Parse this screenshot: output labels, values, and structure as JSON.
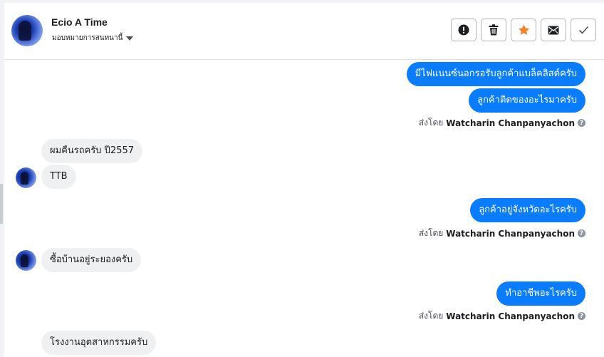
{
  "header": {
    "contact_name": "Ecio A Time",
    "assign_label": "มอบหมายการสนทนานี้"
  },
  "actions": {
    "spam_label": "!",
    "delete_label": "Delete",
    "star_label": "Star",
    "mail_label": "Mark unread",
    "done_label": "Done"
  },
  "messages": {
    "m1": "มีไฟแนนซ์นอกรอรับลูกค้าแบล็คลิสต์ครับ",
    "m2": "ลูกค้าติดของอะไรมาครับ",
    "m3": "ผมคืนรถครับ ปี2557",
    "m4": "TTB",
    "m5": "ลูกค้าอยู่จังหวัดอะไรครับ",
    "m6": "ซื้อบ้านอยู่ระยองครับ",
    "m7": "ทำอาชีพอะไรครับ",
    "m8": "โรงงานอุตสาหกรรมครับ"
  },
  "sent_by": {
    "prefix": "ส่งโดย",
    "agent": "Watcharin Chanpanyachon",
    "help": "?"
  },
  "colors": {
    "outgoing": "#0a7cff",
    "incoming": "#eff0f2",
    "star": "#f5822a"
  },
  "icons": [
    "exclamation-icon",
    "trash-icon",
    "star-icon",
    "envelope-icon",
    "check-icon",
    "caret-down-icon",
    "help-icon"
  ]
}
